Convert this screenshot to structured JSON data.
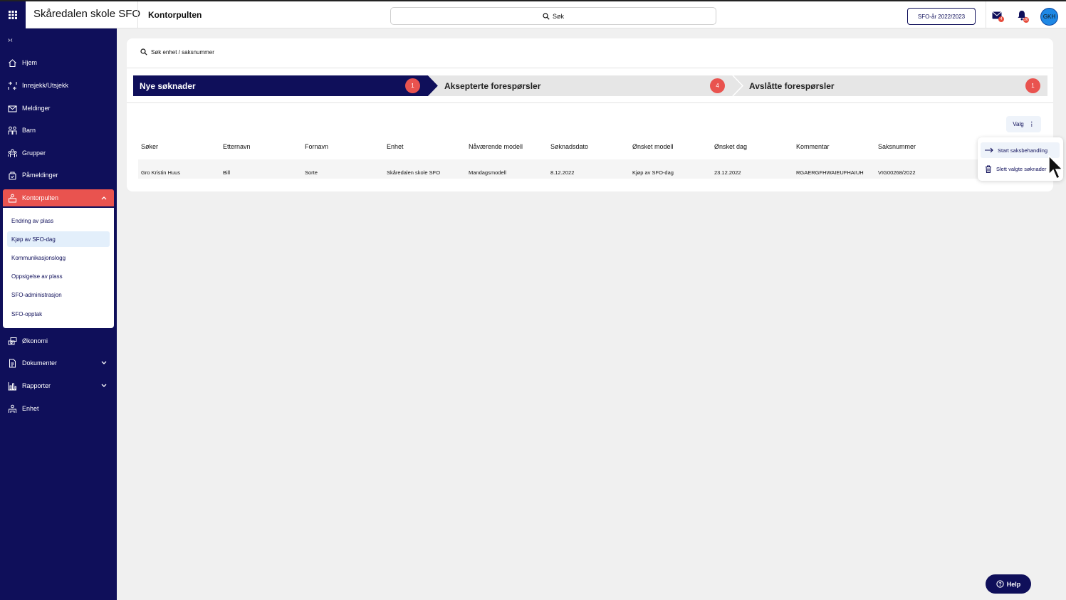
{
  "header": {
    "app_name": "Skåredalen skole SFO",
    "page_title": "Kontorpulten",
    "search_label": "Søk",
    "year_button": "SFO-år 2022/2023",
    "mail_badge": "4",
    "bell_badge": "26",
    "avatar_initials": "GKH"
  },
  "sidebar": {
    "collapse_label": "›‹",
    "items": [
      {
        "label": "Hjem",
        "icon": "home-icon"
      },
      {
        "label": "Innsjekk/Utsjekk",
        "icon": "checkin-icon"
      },
      {
        "label": "Meldinger",
        "icon": "mail-icon"
      },
      {
        "label": "Barn",
        "icon": "children-icon"
      },
      {
        "label": "Grupper",
        "icon": "groups-icon"
      },
      {
        "label": "Påmeldinger",
        "icon": "registration-icon"
      },
      {
        "label": "Kontorpulten",
        "icon": "desk-icon"
      },
      {
        "label": "Økonomi",
        "icon": "money-icon"
      },
      {
        "label": "Dokumenter",
        "icon": "document-icon"
      },
      {
        "label": "Rapporter",
        "icon": "chart-icon"
      },
      {
        "label": "Enhet",
        "icon": "unit-icon"
      }
    ],
    "submenu": [
      {
        "label": "Endring av plass"
      },
      {
        "label": "Kjøp av SFO-dag"
      },
      {
        "label": "Kommunikasjonslogg"
      },
      {
        "label": "Oppsigelse av plass"
      },
      {
        "label": "SFO-administrasjon"
      },
      {
        "label": "SFO-opptak"
      }
    ]
  },
  "main": {
    "search_placeholder": "Søk enhet / saksnummer",
    "tabs": [
      {
        "label": "Nye søknader",
        "count": "1"
      },
      {
        "label": "Aksepterte forespørsler",
        "count": "4"
      },
      {
        "label": "Avslåtte forespørsler",
        "count": "1"
      }
    ],
    "valg_label": "Valg",
    "table": {
      "headers": [
        "Søker",
        "Etternavn",
        "Fornavn",
        "Enhet",
        "Nåværende modell",
        "Søknadsdato",
        "Ønsket modell",
        "Ønsket dag",
        "Kommentar",
        "Saksnummer"
      ],
      "rows": [
        [
          "Gro Kristin Huus",
          "Bill",
          "Sorte",
          "Skåredalen skole SFO",
          "Mandagsmodell",
          "8.12.2022",
          "Kjøp av SFO-dag",
          "23.12.2022",
          "RGAERGFHWAIEUFHAIUH",
          "VIG00268/2022"
        ]
      ]
    },
    "dropdown": [
      {
        "label": "Start saksbehandling",
        "icon": "arrow-right-icon"
      },
      {
        "label": "Slett valgte søknader",
        "icon": "trash-icon"
      }
    ]
  },
  "help_label": "Help",
  "colors": {
    "navy": "#0f0f5a",
    "accent_red": "#e9534f",
    "avatar_blue": "#1e88e5"
  }
}
